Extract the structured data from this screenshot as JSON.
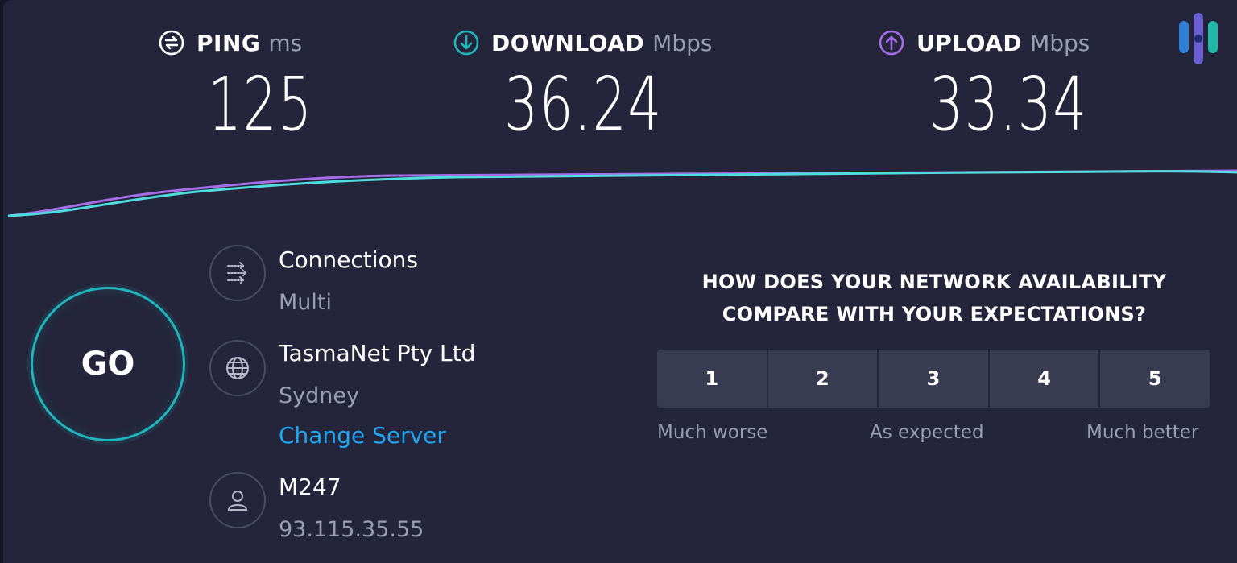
{
  "metrics": {
    "ping": {
      "label": "PING",
      "unit": "ms",
      "value": "125",
      "icon": "ping-icon"
    },
    "download": {
      "label": "DOWNLOAD",
      "unit": "Mbps",
      "value": "36.24",
      "icon": "download-arrow-icon"
    },
    "upload": {
      "label": "UPLOAD",
      "unit": "Mbps",
      "value": "33.34",
      "icon": "upload-arrow-icon"
    }
  },
  "go": {
    "label": "GO"
  },
  "connection": {
    "title": "Connections",
    "value": "Multi",
    "icon": "connections-icon"
  },
  "server": {
    "title": "TasmaNet Pty Ltd",
    "location": "Sydney",
    "change_label": "Change Server",
    "icon": "globe-icon"
  },
  "provider": {
    "title": "M247",
    "ip": "93.115.35.55",
    "icon": "user-icon"
  },
  "survey": {
    "question_line1": "HOW DOES YOUR NETWORK AVAILABILITY",
    "question_line2": "COMPARE WITH YOUR EXPECTATIONS?",
    "options": [
      "1",
      "2",
      "3",
      "4",
      "5"
    ],
    "low_label": "Much worse",
    "mid_label": "As expected",
    "high_label": "Much better"
  },
  "colors": {
    "background": "#24253a",
    "download_accent": "#1fb7bd",
    "upload_accent": "#a56ee8",
    "link": "#1da6f2",
    "muted_text": "#9b9db1"
  }
}
